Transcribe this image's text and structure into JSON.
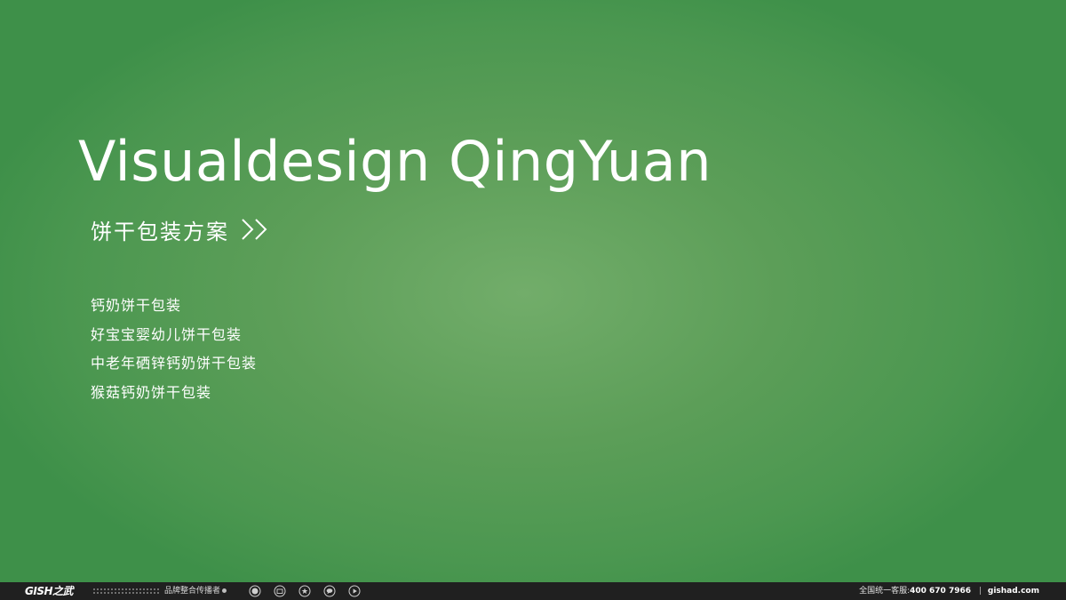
{
  "slide": {
    "title": "Visualdesign QingYuan",
    "subtitle": "饼干包装方案",
    "subtitle_icon": "double-chevron-right-icon",
    "items": [
      "钙奶饼干包装",
      "好宝宝婴幼儿饼干包装",
      "中老年硒锌钙奶饼干包装",
      "猴菇钙奶饼干包装"
    ],
    "colors": {
      "background_center": "#72ad6a",
      "background_edge": "#3e9049",
      "text": "#ffffff"
    }
  },
  "footer": {
    "logo": "GISH之武",
    "tagline": "品牌整合传播者",
    "icons": [
      "circle-arrow-icon",
      "mail-icon",
      "star-icon",
      "chat-icon",
      "play-icon"
    ],
    "hotline_label": "全国统一客服:",
    "hotline_number": "400 670 7966",
    "separator": "|",
    "website": "gishad.com",
    "background": "#202020"
  }
}
